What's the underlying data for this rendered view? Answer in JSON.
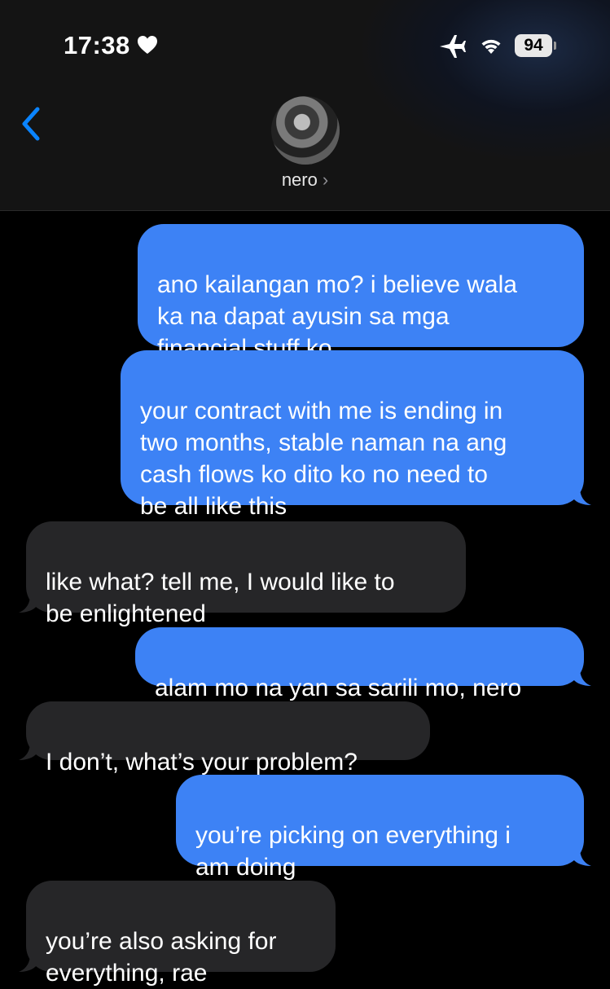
{
  "status_bar": {
    "time": "17:38",
    "battery": "94",
    "icons": [
      "heart-icon",
      "airplane-icon",
      "wifi-icon",
      "battery-icon"
    ]
  },
  "header": {
    "contact_name": "nero",
    "contact_chevron": "›"
  },
  "colors": {
    "sent_bubble": "#3d82f5",
    "received_bubble": "#262628",
    "accent": "#0a84ff"
  },
  "messages": [
    {
      "direction": "sent",
      "text": "ano kailangan mo? i believe wala\nka na dapat ayusin sa mga\nfinancial stuff ko"
    },
    {
      "direction": "sent",
      "text": "your contract with me is ending in\ntwo months, stable naman na ang\ncash flows ko dito ko no need to\nbe all like this"
    },
    {
      "direction": "received",
      "text": "like what? tell me, I would like to\nbe enlightened"
    },
    {
      "direction": "sent",
      "text": "alam mo na yan sa sarili mo, nero"
    },
    {
      "direction": "received",
      "text": "I don’t, what’s your problem?"
    },
    {
      "direction": "sent",
      "text": "you’re picking on everything i\nam doing"
    },
    {
      "direction": "received",
      "text": "you’re also asking for\neverything, rae"
    }
  ]
}
